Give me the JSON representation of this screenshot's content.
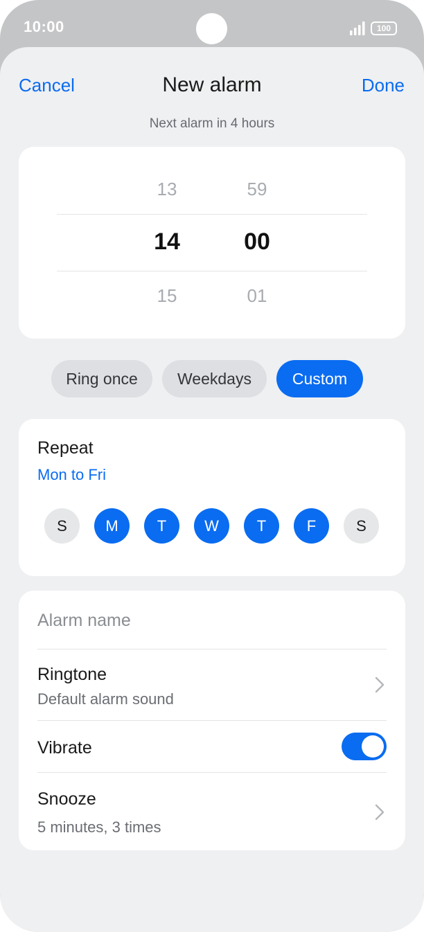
{
  "status_bar": {
    "time": "10:00",
    "battery": "100",
    "icons": [
      "signal-icon",
      "battery-icon"
    ]
  },
  "header": {
    "cancel_label": "Cancel",
    "title": "New alarm",
    "done_label": "Done",
    "subtitle": "Next alarm in 4 hours"
  },
  "time_picker": {
    "hour_prev": "13",
    "hour": "14",
    "hour_next": "15",
    "minute_prev": "59",
    "minute": "00",
    "minute_next": "01"
  },
  "presets": [
    {
      "label": "Ring once",
      "selected": false
    },
    {
      "label": "Weekdays",
      "selected": false
    },
    {
      "label": "Custom",
      "selected": true
    }
  ],
  "repeat": {
    "label": "Repeat",
    "value": "Mon to Fri",
    "days": [
      {
        "letter": "S",
        "selected": false
      },
      {
        "letter": "M",
        "selected": true
      },
      {
        "letter": "T",
        "selected": true
      },
      {
        "letter": "W",
        "selected": true
      },
      {
        "letter": "T",
        "selected": true
      },
      {
        "letter": "F",
        "selected": true
      },
      {
        "letter": "S",
        "selected": false
      }
    ]
  },
  "settings": {
    "alarm_name_placeholder": "Alarm name",
    "alarm_name_value": "",
    "ringtone_title": "Ringtone",
    "ringtone_value": "Default alarm sound",
    "vibrate_title": "Vibrate",
    "vibrate_on": true,
    "snooze_title": "Snooze",
    "snooze_value": "5 minutes, 3 times"
  },
  "colors": {
    "accent": "#0a6cf0",
    "background": "#eff0f2",
    "frame": "#c4c5c7"
  }
}
